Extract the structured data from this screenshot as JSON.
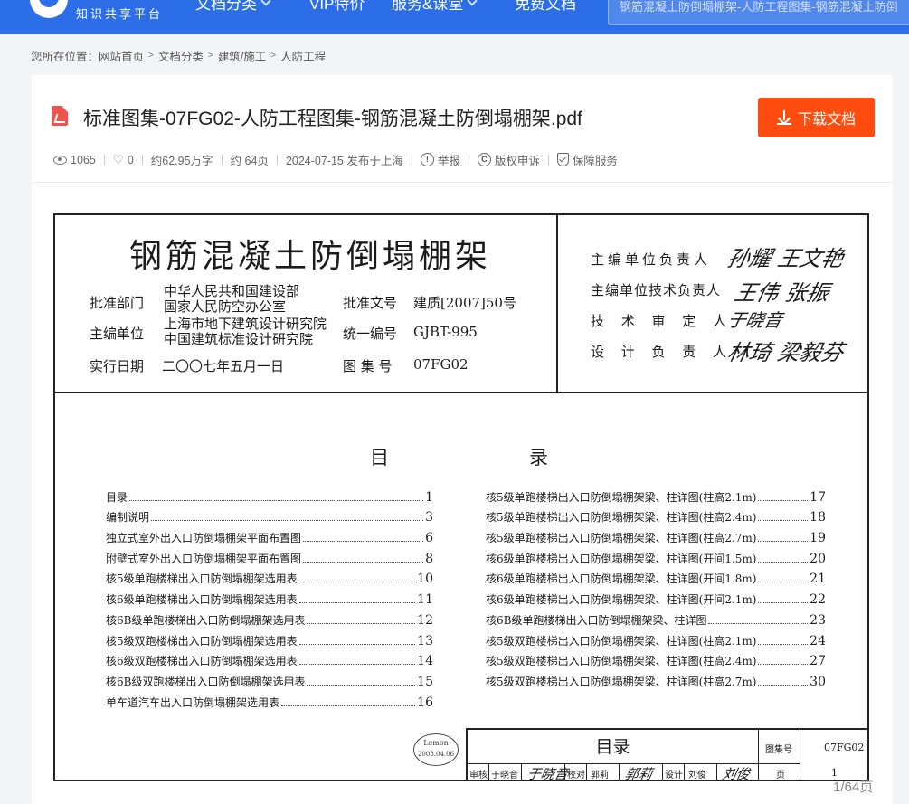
{
  "site": {
    "logo_text": "知识共享平台"
  },
  "nav": {
    "items": [
      {
        "label": "文档分类"
      },
      {
        "label": "VIP特价"
      },
      {
        "label": "服务&课堂"
      },
      {
        "label": "免费文档"
      }
    ],
    "search_value": "钢筋混凝土防倒塌棚架-人防工程图集-钢筋混凝土防倒"
  },
  "breadcrumb": {
    "prefix": "您所在位置：",
    "items": [
      "网站首页",
      "文档分类",
      "建筑/施工",
      "人防工程"
    ]
  },
  "doc": {
    "title": "标准图集-07FG02-人防工程图集-钢筋混凝土防倒塌棚架.pdf",
    "download_label": "下载文档",
    "views": "1065",
    "likes": "0",
    "words": "约62.95万字",
    "pages": "约 64页",
    "published": "2024-07-15 发布于上海",
    "report": "举报",
    "copyright": "版权申诉",
    "guarantee": "保障服务",
    "page_counter": "1/64页"
  },
  "atlas": {
    "title": "钢筋混凝土防倒塌棚架",
    "approve_dept_label": "批准部门",
    "approve_dept_1": "中华人民共和国建设部",
    "approve_dept_2": "国家人民防空办公室",
    "approve_no_label": "批准文号",
    "approve_no": "建质[2007]50号",
    "editor_label": "主编单位",
    "editor_1": "上海市地下建筑设计研究院",
    "editor_2": "中国建筑标准设计研究院",
    "unified_no_label": "统一编号",
    "unified_no": "GJBT-995",
    "date_label": "实行日期",
    "date": "二〇〇七年五月一日",
    "atlas_no_label": "图 集 号",
    "atlas_no": "07FG02",
    "sig_labels": [
      "主编单位负责人",
      "主编单位技术负责人",
      "技 术 审 定 人",
      "设 计 负 责 人"
    ],
    "signatures": [
      "孙耀 王文艳",
      "王伟  张振",
      "于晓音",
      "林琦 梁毅芬"
    ],
    "toc_head_1": "目",
    "toc_head_2": "录",
    "toc_left": [
      {
        "text": "目录",
        "page": "1"
      },
      {
        "text": "编制说明",
        "page": "3"
      },
      {
        "text": "独立式室外出入口防倒塌棚架平面布置图",
        "page": "6"
      },
      {
        "text": "附壁式室外出入口防倒塌棚架平面布置图",
        "page": "8"
      },
      {
        "text": "核5级单跑楼梯出入口防倒塌棚架选用表",
        "page": "10"
      },
      {
        "text": "核6级单跑楼梯出入口防倒塌棚架选用表",
        "page": "11"
      },
      {
        "text": "核6B级单跑楼梯出入口防倒塌棚架选用表",
        "page": "12"
      },
      {
        "text": "核5级双跑楼梯出入口防倒塌棚架选用表",
        "page": "13"
      },
      {
        "text": "核6级双跑楼梯出入口防倒塌棚架选用表",
        "page": "14"
      },
      {
        "text": "核6B级双跑楼梯出入口防倒塌棚架选用表",
        "page": "15"
      },
      {
        "text": "单车道汽车出入口防倒塌棚架选用表",
        "page": "16"
      }
    ],
    "toc_right": [
      {
        "text": "核5级单跑楼梯出入口防倒塌棚架梁、柱详图(柱高2.1m)",
        "page": "17"
      },
      {
        "text": "核5级单跑楼梯出入口防倒塌棚架梁、柱详图(柱高2.4m)",
        "page": "18"
      },
      {
        "text": "核5级单跑楼梯出入口防倒塌棚架梁、柱详图(柱高2.7m)",
        "page": "19"
      },
      {
        "text": "核6级单跑楼梯出入口防倒塌棚架梁、柱详图(开间1.5m)",
        "page": "20"
      },
      {
        "text": "核6级单跑楼梯出入口防倒塌棚架梁、柱详图(开间1.8m)",
        "page": "21"
      },
      {
        "text": "核6级单跑楼梯出入口防倒塌棚架梁、柱详图(开间2.1m)",
        "page": "22"
      },
      {
        "text": "核6B级单跑楼梯出入口防倒塌棚架梁、柱详图",
        "page": "23"
      },
      {
        "text": "核5级双跑楼梯出入口防倒塌棚架梁、柱详图(柱高2.1m)",
        "page": "24"
      },
      {
        "text": "核5级双跑楼梯出入口防倒塌棚架梁、柱详图(柱高2.4m)",
        "page": "27"
      },
      {
        "text": "核5级双跑楼梯出入口防倒塌棚架梁、柱详图(柱高2.7m)",
        "page": "30"
      }
    ],
    "tb_name": "目录",
    "tb_atlas_label": "图集号",
    "tb_atlas_no": "07FG02",
    "tb_review_label": "审核",
    "tb_review_name": "于晓音",
    "tb_review_sig": "于晓音",
    "tb_check_label": "校对",
    "tb_check_name": "郭莉",
    "tb_check_sig": "郭莉",
    "tb_design_label": "设计",
    "tb_design_name": "刘俊",
    "tb_design_sig": "刘俊",
    "tb_page_label": "页",
    "tb_page": "1",
    "stamp_1": "Lemon",
    "stamp_2": "2008.04.06"
  },
  "colors": {
    "nav_bg": "#2b6ee8",
    "download_bg": "#ff4d10",
    "pdf_icon": "#ef5350"
  }
}
